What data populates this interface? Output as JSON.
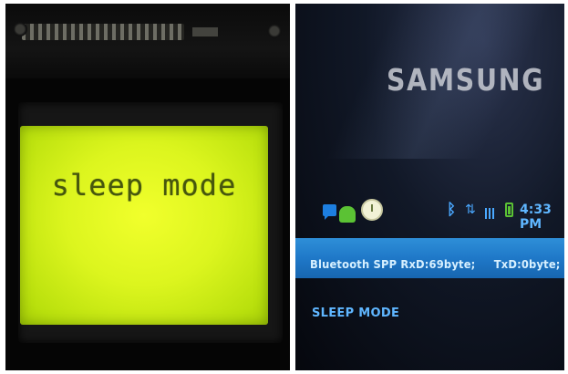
{
  "lcd_panel": {
    "display_text": "sleep mode"
  },
  "phone_panel": {
    "brand": "SAMSUNG",
    "status_bar": {
      "time": "4:33 PM",
      "icons": [
        "message-icon",
        "android-icon",
        "clock-icon",
        "bluetooth-icon",
        "network-icon",
        "signal-icon",
        "battery-icon"
      ]
    },
    "notification": {
      "rx_text": "Bluetooth SPP RxD:69byte;",
      "tx_text": "TxD:0byte;"
    },
    "mode_text": "SLEEP MODE"
  },
  "colors": {
    "lcd_backlight": "#dcf51e",
    "lcd_text": "#3a4a0c",
    "notification_bar": "#1f78c8",
    "phone_text": "#5fb6ff"
  }
}
